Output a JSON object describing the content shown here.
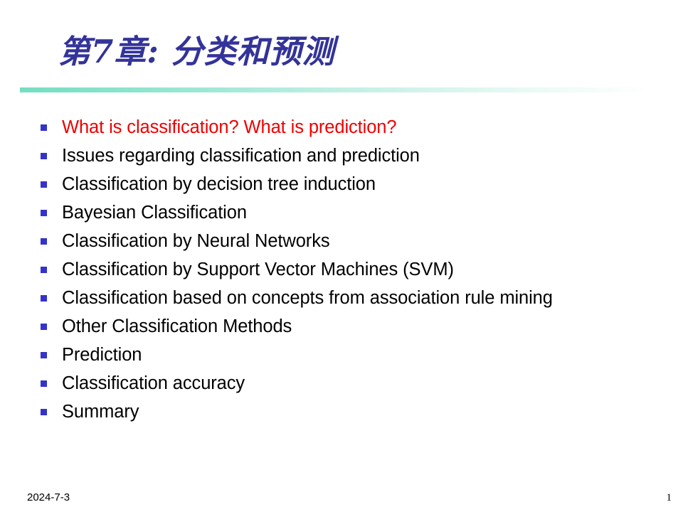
{
  "slide": {
    "title": "第7章: 分类和预测",
    "title_color": "#333399",
    "divider_start_color": "#74dec0",
    "divider_end_color": "#ffffff",
    "background_color": "#ffffff",
    "bullet_marker_color": "#3333cc",
    "highlight_color": "#ee0000",
    "body_color": "#000000"
  },
  "bullets": [
    {
      "text": "What is classification? What is prediction?",
      "highlighted": true
    },
    {
      "text": "Issues regarding classification and prediction",
      "highlighted": false
    },
    {
      "text": "Classification by decision tree induction",
      "highlighted": false
    },
    {
      "text": "Bayesian Classification",
      "highlighted": false
    },
    {
      "text": "Classification by Neural Networks",
      "highlighted": false
    },
    {
      "text": "Classification by Support Vector Machines (SVM)",
      "highlighted": false
    },
    {
      "text": "Classification based on concepts from association rule mining",
      "highlighted": false,
      "wrapped": true
    },
    {
      "text": "Other Classification Methods",
      "highlighted": false
    },
    {
      "text": "Prediction",
      "highlighted": false
    },
    {
      "text": "Classification accuracy",
      "highlighted": false
    },
    {
      "text": "Summary",
      "highlighted": false
    }
  ],
  "footer": {
    "date": "2024-7-3",
    "page_number": "1"
  }
}
